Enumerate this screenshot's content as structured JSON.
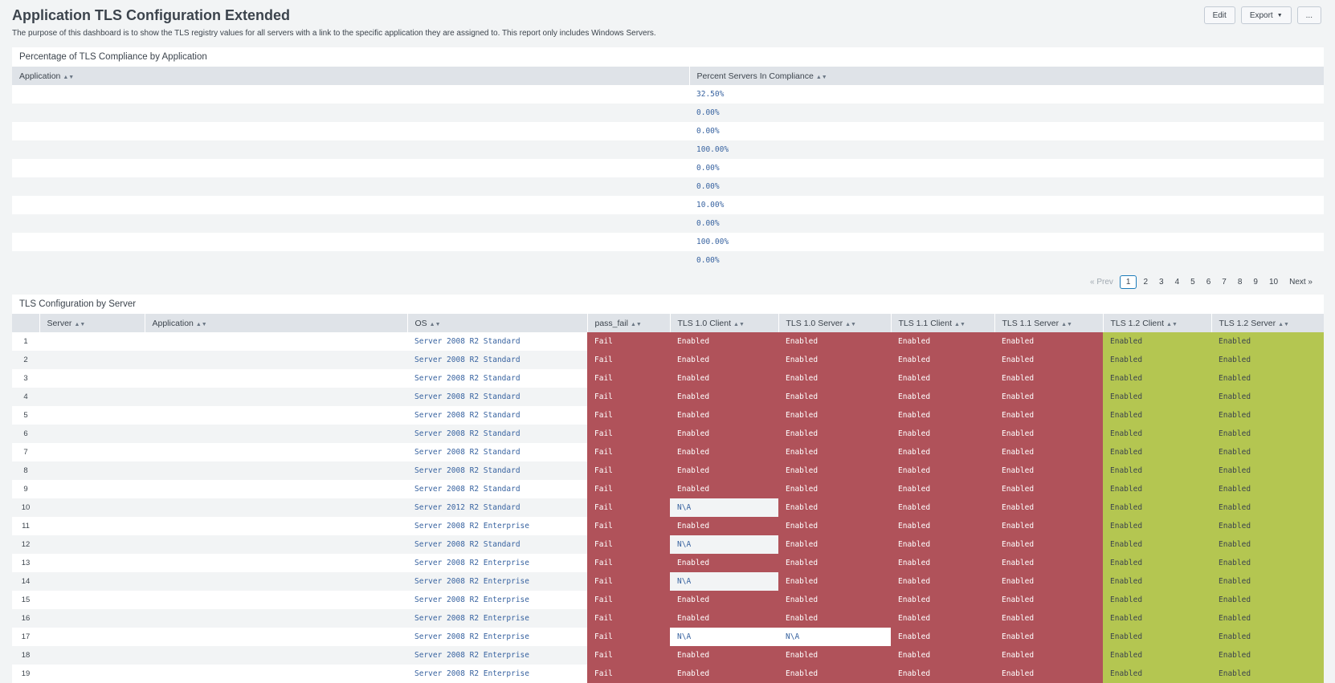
{
  "page": {
    "title": "Application TLS Configuration Extended",
    "description": "The purpose of this dashboard is to show the TLS registry values for all servers with a link to the specific application they are assigned to. This report only includes Windows Servers.",
    "actions": {
      "edit": "Edit",
      "export": "Export",
      "more": "..."
    }
  },
  "compliance": {
    "title": "Percentage of TLS Compliance by Application",
    "columns": [
      "Application",
      "Percent Servers In Compliance"
    ],
    "rows": [
      {
        "application": "",
        "percent": "32.50%"
      },
      {
        "application": "",
        "percent": "0.00%"
      },
      {
        "application": "",
        "percent": "0.00%"
      },
      {
        "application": "",
        "percent": "100.00%"
      },
      {
        "application": "",
        "percent": "0.00%"
      },
      {
        "application": "",
        "percent": "0.00%"
      },
      {
        "application": "",
        "percent": "10.00%"
      },
      {
        "application": "",
        "percent": "0.00%"
      },
      {
        "application": "",
        "percent": "100.00%"
      },
      {
        "application": "",
        "percent": "0.00%"
      }
    ],
    "pager": {
      "prev": "« Prev",
      "pages": [
        "1",
        "2",
        "3",
        "4",
        "5",
        "6",
        "7",
        "8",
        "9",
        "10"
      ],
      "current": "1",
      "next": "Next »"
    }
  },
  "servers": {
    "title": "TLS Configuration by Server",
    "columns": [
      "",
      "Server",
      "Application",
      "OS",
      "pass_fail",
      "TLS 1.0 Client",
      "TLS 1.0 Server",
      "TLS 1.1 Client",
      "TLS 1.1 Server",
      "TLS 1.2 Client",
      "TLS 1.2 Server"
    ],
    "colors": {
      "fail": "#b0525a",
      "pass": "#b4c651",
      "na": "#ffffff"
    },
    "rows": [
      {
        "n": "1",
        "server": "",
        "application": "",
        "os": "Server 2008 R2 Standard",
        "pass_fail": "Fail",
        "tls10c": "Enabled",
        "tls10s": "Enabled",
        "tls11c": "Enabled",
        "tls11s": "Enabled",
        "tls12c": "Enabled",
        "tls12s": "Enabled"
      },
      {
        "n": "2",
        "server": "",
        "application": "",
        "os": "Server 2008 R2 Standard",
        "pass_fail": "Fail",
        "tls10c": "Enabled",
        "tls10s": "Enabled",
        "tls11c": "Enabled",
        "tls11s": "Enabled",
        "tls12c": "Enabled",
        "tls12s": "Enabled"
      },
      {
        "n": "3",
        "server": "",
        "application": "",
        "os": "Server 2008 R2 Standard",
        "pass_fail": "Fail",
        "tls10c": "Enabled",
        "tls10s": "Enabled",
        "tls11c": "Enabled",
        "tls11s": "Enabled",
        "tls12c": "Enabled",
        "tls12s": "Enabled"
      },
      {
        "n": "4",
        "server": "",
        "application": "",
        "os": "Server 2008 R2 Standard",
        "pass_fail": "Fail",
        "tls10c": "Enabled",
        "tls10s": "Enabled",
        "tls11c": "Enabled",
        "tls11s": "Enabled",
        "tls12c": "Enabled",
        "tls12s": "Enabled"
      },
      {
        "n": "5",
        "server": "",
        "application": "",
        "os": "Server 2008 R2 Standard",
        "pass_fail": "Fail",
        "tls10c": "Enabled",
        "tls10s": "Enabled",
        "tls11c": "Enabled",
        "tls11s": "Enabled",
        "tls12c": "Enabled",
        "tls12s": "Enabled"
      },
      {
        "n": "6",
        "server": "",
        "application": "",
        "os": "Server 2008 R2 Standard",
        "pass_fail": "Fail",
        "tls10c": "Enabled",
        "tls10s": "Enabled",
        "tls11c": "Enabled",
        "tls11s": "Enabled",
        "tls12c": "Enabled",
        "tls12s": "Enabled"
      },
      {
        "n": "7",
        "server": "",
        "application": "",
        "os": "Server 2008 R2 Standard",
        "pass_fail": "Fail",
        "tls10c": "Enabled",
        "tls10s": "Enabled",
        "tls11c": "Enabled",
        "tls11s": "Enabled",
        "tls12c": "Enabled",
        "tls12s": "Enabled"
      },
      {
        "n": "8",
        "server": "",
        "application": "",
        "os": "Server 2008 R2 Standard",
        "pass_fail": "Fail",
        "tls10c": "Enabled",
        "tls10s": "Enabled",
        "tls11c": "Enabled",
        "tls11s": "Enabled",
        "tls12c": "Enabled",
        "tls12s": "Enabled"
      },
      {
        "n": "9",
        "server": "",
        "application": "",
        "os": "Server 2008 R2 Standard",
        "pass_fail": "Fail",
        "tls10c": "Enabled",
        "tls10s": "Enabled",
        "tls11c": "Enabled",
        "tls11s": "Enabled",
        "tls12c": "Enabled",
        "tls12s": "Enabled"
      },
      {
        "n": "10",
        "server": "",
        "application": "",
        "os": "Server 2012 R2 Standard",
        "pass_fail": "Fail",
        "tls10c": "N\\A",
        "tls10s": "Enabled",
        "tls11c": "Enabled",
        "tls11s": "Enabled",
        "tls12c": "Enabled",
        "tls12s": "Enabled"
      },
      {
        "n": "11",
        "server": "",
        "application": "",
        "os": "Server 2008 R2 Enterprise",
        "pass_fail": "Fail",
        "tls10c": "Enabled",
        "tls10s": "Enabled",
        "tls11c": "Enabled",
        "tls11s": "Enabled",
        "tls12c": "Enabled",
        "tls12s": "Enabled"
      },
      {
        "n": "12",
        "server": "",
        "application": "",
        "os": "Server 2008 R2 Standard",
        "pass_fail": "Fail",
        "tls10c": "N\\A",
        "tls10s": "Enabled",
        "tls11c": "Enabled",
        "tls11s": "Enabled",
        "tls12c": "Enabled",
        "tls12s": "Enabled"
      },
      {
        "n": "13",
        "server": "",
        "application": "",
        "os": "Server 2008 R2 Enterprise",
        "pass_fail": "Fail",
        "tls10c": "Enabled",
        "tls10s": "Enabled",
        "tls11c": "Enabled",
        "tls11s": "Enabled",
        "tls12c": "Enabled",
        "tls12s": "Enabled"
      },
      {
        "n": "14",
        "server": "",
        "application": "",
        "os": "Server 2008 R2 Enterprise",
        "pass_fail": "Fail",
        "tls10c": "N\\A",
        "tls10s": "Enabled",
        "tls11c": "Enabled",
        "tls11s": "Enabled",
        "tls12c": "Enabled",
        "tls12s": "Enabled"
      },
      {
        "n": "15",
        "server": "",
        "application": "",
        "os": "Server 2008 R2 Enterprise",
        "pass_fail": "Fail",
        "tls10c": "Enabled",
        "tls10s": "Enabled",
        "tls11c": "Enabled",
        "tls11s": "Enabled",
        "tls12c": "Enabled",
        "tls12s": "Enabled"
      },
      {
        "n": "16",
        "server": "",
        "application": "",
        "os": "Server 2008 R2 Enterprise",
        "pass_fail": "Fail",
        "tls10c": "Enabled",
        "tls10s": "Enabled",
        "tls11c": "Enabled",
        "tls11s": "Enabled",
        "tls12c": "Enabled",
        "tls12s": "Enabled"
      },
      {
        "n": "17",
        "server": "",
        "application": "",
        "os": "Server 2008 R2 Enterprise",
        "pass_fail": "Fail",
        "tls10c": "N\\A",
        "tls10s": "N\\A",
        "tls11c": "Enabled",
        "tls11s": "Enabled",
        "tls12c": "Enabled",
        "tls12s": "Enabled"
      },
      {
        "n": "18",
        "server": "",
        "application": "",
        "os": "Server 2008 R2 Enterprise",
        "pass_fail": "Fail",
        "tls10c": "Enabled",
        "tls10s": "Enabled",
        "tls11c": "Enabled",
        "tls11s": "Enabled",
        "tls12c": "Enabled",
        "tls12s": "Enabled"
      },
      {
        "n": "19",
        "server": "",
        "application": "",
        "os": "Server 2008 R2 Enterprise",
        "pass_fail": "Fail",
        "tls10c": "Enabled",
        "tls10s": "Enabled",
        "tls11c": "Enabled",
        "tls11s": "Enabled",
        "tls12c": "Enabled",
        "tls12s": "Enabled"
      }
    ]
  }
}
